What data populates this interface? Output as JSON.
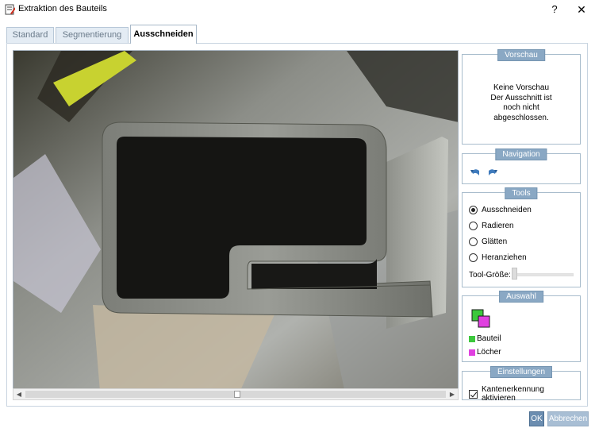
{
  "window": {
    "title": "Extraktion des Bauteils",
    "help_label": "?",
    "close_label": "✕"
  },
  "tabs": [
    {
      "label": "Standard",
      "active": false
    },
    {
      "label": "Segmentierung",
      "active": false
    },
    {
      "label": "Ausschneiden",
      "active": true
    }
  ],
  "viewport": {
    "image_description_icon": "photo-of-aluminium-profile"
  },
  "preview": {
    "title": "Vorschau",
    "line1": "Keine Vorschau",
    "line2": "Der Ausschnitt ist",
    "line3": "noch nicht",
    "line4": "abgeschlossen."
  },
  "navigation": {
    "title": "Navigation",
    "icons": [
      "undo-icon",
      "redo-icon"
    ]
  },
  "tools": {
    "title": "Tools",
    "options": [
      {
        "label": "Ausschneiden",
        "checked": true
      },
      {
        "label": "Radieren",
        "checked": false
      },
      {
        "label": "Glätten",
        "checked": false
      },
      {
        "label": "Heranziehen",
        "checked": false
      }
    ],
    "size_label": "Tool-Größe:",
    "size_value": 0
  },
  "selection": {
    "title": "Auswahl",
    "items": [
      {
        "label": "Bauteil",
        "color": "#3cc83c"
      },
      {
        "label": "Löcher",
        "color": "#e040e0"
      }
    ]
  },
  "settings": {
    "title": "Einstellungen",
    "edge_detection_label": "Kantenerkennung aktivieren",
    "edge_detection_checked": true
  },
  "footer": {
    "ok_label": "OK",
    "cancel_label": "Abbrechen"
  },
  "colors": {
    "accent": "#8aa8c4",
    "ok_button": "#6b8db0",
    "cancel_button": "#a8bed4"
  }
}
